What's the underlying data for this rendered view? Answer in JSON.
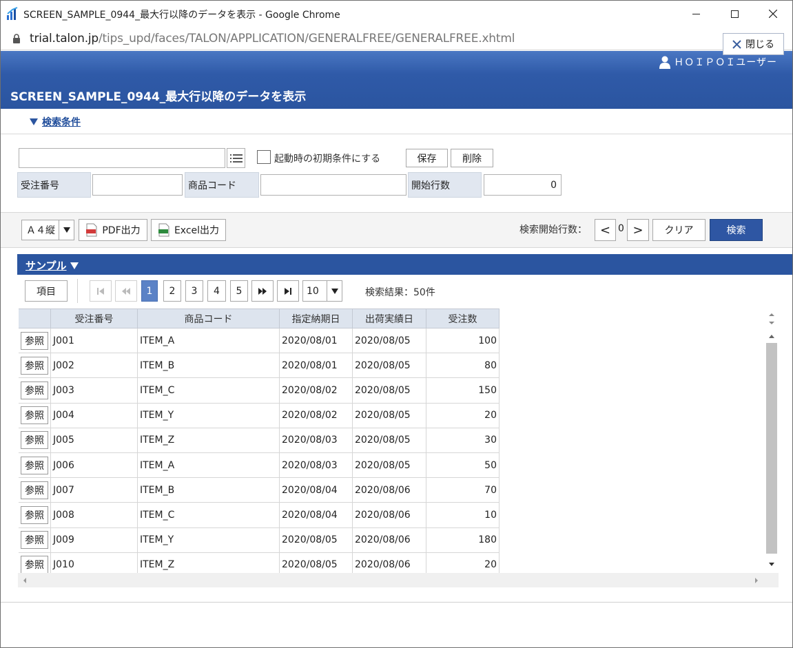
{
  "window": {
    "title": "SCREEN_SAMPLE_0944_最大行以降のデータを表示 - Google Chrome",
    "url_host": "trial.talon.jp",
    "url_path": "/tips_upd/faces/TALON/APPLICATION/GENERALFREE/GENERALFREE.xhtml"
  },
  "header": {
    "user": "ＨＯＩＰＯＩユーザー",
    "title": "SCREEN_SAMPLE_0944_最大行以降のデータを表示",
    "close_label": "閉じる"
  },
  "search_cond": {
    "toggle_label": "検索条件",
    "preset_value": "",
    "init_checkbox_label": "起動時の初期条件にする",
    "save_label": "保存",
    "delete_label": "削除",
    "fields": {
      "order_no_label": "受注番号",
      "order_no_value": "",
      "product_code_label": "商品コード",
      "product_code_value": "",
      "start_row_label": "開始行数",
      "start_row_value": "0"
    }
  },
  "toolbar": {
    "paper_select": "Ａ４縦",
    "pdf_label": "PDF出力",
    "excel_label": "Excel出力",
    "search_start_label": "検索開始行数：",
    "prev": "<",
    "start_value": "0",
    "next": ">",
    "clear_label": "クリア",
    "search_label": "検索"
  },
  "panel": {
    "title": "サンプル",
    "columns_button": "項目",
    "pages": [
      "1",
      "2",
      "3",
      "4",
      "5"
    ],
    "active_page": "1",
    "page_size": "10",
    "result_text": "検索結果：50件"
  },
  "table": {
    "headers": [
      "",
      "受注番号",
      "商品コード",
      "指定納期日",
      "出荷実績日",
      "受注数"
    ],
    "ref_label": "参照",
    "rows": [
      {
        "order": "J001",
        "item": "ITEM_A",
        "due": "2020/08/01",
        "ship": "2020/08/05",
        "qty": "100"
      },
      {
        "order": "J002",
        "item": "ITEM_B",
        "due": "2020/08/01",
        "ship": "2020/08/05",
        "qty": "80"
      },
      {
        "order": "J003",
        "item": "ITEM_C",
        "due": "2020/08/02",
        "ship": "2020/08/05",
        "qty": "150"
      },
      {
        "order": "J004",
        "item": "ITEM_Y",
        "due": "2020/08/02",
        "ship": "2020/08/05",
        "qty": "20"
      },
      {
        "order": "J005",
        "item": "ITEM_Z",
        "due": "2020/08/03",
        "ship": "2020/08/05",
        "qty": "30"
      },
      {
        "order": "J006",
        "item": "ITEM_A",
        "due": "2020/08/03",
        "ship": "2020/08/05",
        "qty": "50"
      },
      {
        "order": "J007",
        "item": "ITEM_B",
        "due": "2020/08/04",
        "ship": "2020/08/06",
        "qty": "70"
      },
      {
        "order": "J008",
        "item": "ITEM_C",
        "due": "2020/08/04",
        "ship": "2020/08/06",
        "qty": "10"
      },
      {
        "order": "J009",
        "item": "ITEM_Y",
        "due": "2020/08/05",
        "ship": "2020/08/06",
        "qty": "180"
      },
      {
        "order": "J010",
        "item": "ITEM_Z",
        "due": "2020/08/05",
        "ship": "2020/08/06",
        "qty": "20"
      }
    ]
  }
}
